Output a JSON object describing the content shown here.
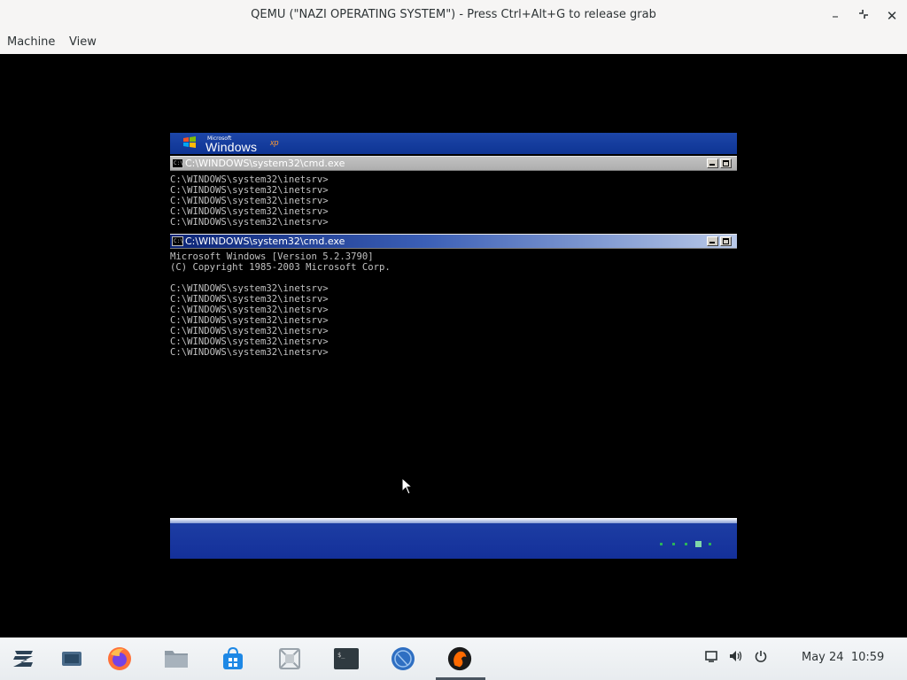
{
  "window": {
    "title": "QEMU (\"NAZI OPERATING SYSTEM\") - Press Ctrl+Alt+G to release grab",
    "menu": [
      "Machine",
      "View"
    ]
  },
  "guest": {
    "xp_logo": {
      "microsoft": "Microsoft",
      "windows": "Windows",
      "xp": "xp"
    },
    "cmd_windows": [
      {
        "title": "C:\\WINDOWS\\system32\\cmd.exe",
        "active": false,
        "lines": [
          "C:\\WINDOWS\\system32\\inetsrv>",
          "C:\\WINDOWS\\system32\\inetsrv>",
          "C:\\WINDOWS\\system32\\inetsrv>",
          "C:\\WINDOWS\\system32\\inetsrv>",
          "C:\\WINDOWS\\system32\\inetsrv>"
        ]
      },
      {
        "title": "C:\\WINDOWS\\system32\\cmd.exe",
        "active": true,
        "lines": [
          "Microsoft Windows [Version 5.2.3790]",
          "(C) Copyright 1985-2003 Microsoft Corp.",
          "",
          "C:\\WINDOWS\\system32\\inetsrv>",
          "C:\\WINDOWS\\system32\\inetsrv>",
          "C:\\WINDOWS\\system32\\inetsrv>",
          "C:\\WINDOWS\\system32\\inetsrv>",
          "C:\\WINDOWS\\system32\\inetsrv>",
          "C:\\WINDOWS\\system32\\inetsrv>",
          "C:\\WINDOWS\\system32\\inetsrv>"
        ]
      }
    ]
  },
  "dock": {
    "apps": [
      "zorin-menu-icon",
      "workspaces-icon",
      "firefox-icon",
      "files-icon",
      "software-store-icon",
      "archive-icon",
      "terminal-icon",
      "network-globe-icon",
      "qemu-icon"
    ],
    "clock": {
      "date": "May 24",
      "time": "10:59"
    }
  },
  "colors": {
    "xp_blue": "#1d46a8",
    "console_text": "#c0c0c0",
    "dock_bg": "#eef1f3"
  }
}
